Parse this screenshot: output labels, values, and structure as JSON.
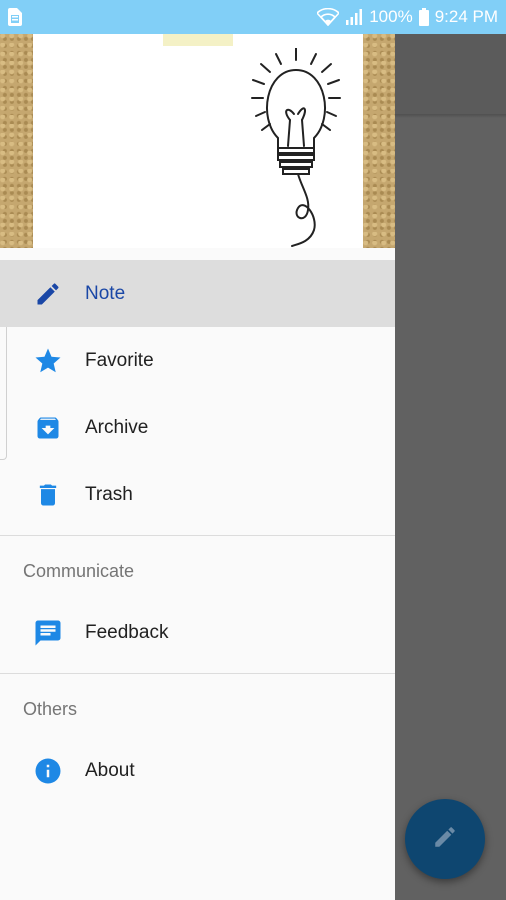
{
  "status_bar": {
    "battery_text": "100%",
    "time": "9:24 PM",
    "icons": [
      "sim-icon",
      "wifi-icon",
      "signal-icon",
      "battery-icon"
    ]
  },
  "drawer": {
    "primary_items": [
      {
        "label": "Note",
        "icon": "pencil-icon",
        "active": true
      },
      {
        "label": "Favorite",
        "icon": "star-icon",
        "active": false
      },
      {
        "label": "Archive",
        "icon": "archive-icon",
        "active": false
      },
      {
        "label": "Trash",
        "icon": "trash-icon",
        "active": false
      }
    ],
    "communicate": {
      "title": "Communicate",
      "items": [
        {
          "label": "Feedback",
          "icon": "feedback-icon"
        }
      ]
    },
    "others": {
      "title": "Others",
      "items": [
        {
          "label": "About",
          "icon": "info-icon"
        }
      ]
    }
  },
  "fab": {
    "icon": "edit-icon"
  },
  "colors": {
    "status_bar": "#81cff7",
    "accent_blue": "#1e88e5",
    "active_text": "#1a47a6",
    "fab": "#0e4670",
    "scrim": "#616161"
  }
}
